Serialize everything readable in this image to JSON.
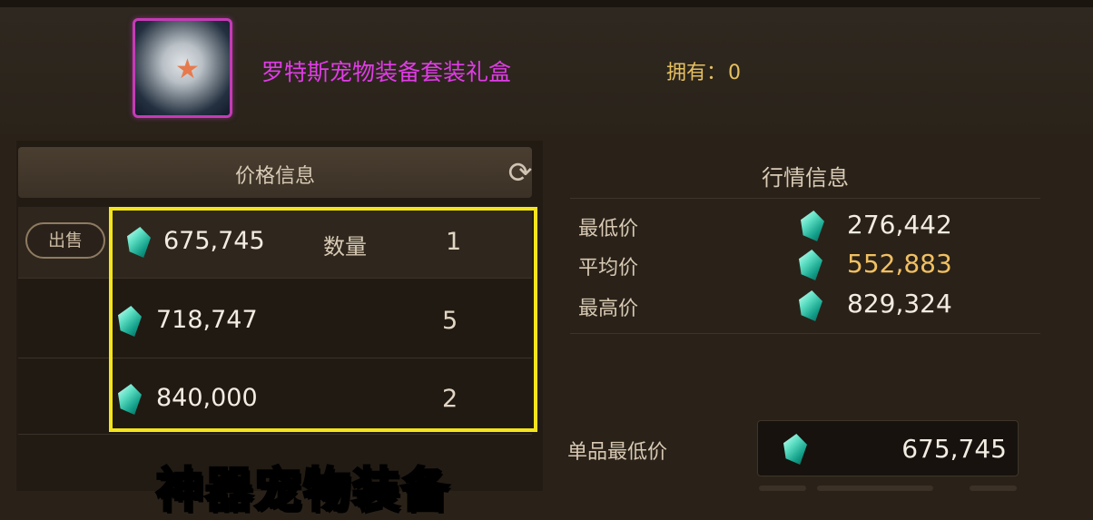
{
  "item": {
    "name": "罗特斯宠物装备套装礼盒",
    "owned_label": "拥有：",
    "owned_value": "0",
    "icon": "clam-shell-gift-box-icon"
  },
  "price_panel": {
    "title": "价格信息",
    "refresh_icon": "refresh-icon",
    "sell_button": "出售",
    "quantity_label": "数量",
    "currency_icon": "teal-crystal-icon",
    "listings": [
      {
        "price": "675,745",
        "quantity": "1"
      },
      {
        "price": "718,747",
        "quantity": "5"
      },
      {
        "price": "840,000",
        "quantity": "2"
      }
    ]
  },
  "market_panel": {
    "title": "行情信息",
    "rows": [
      {
        "label": "最低价",
        "value": "276,442"
      },
      {
        "label": "平均价",
        "value": "552,883"
      },
      {
        "label": "最高价",
        "value": "829,324"
      }
    ],
    "unit_min_label": "单品最低价",
    "unit_min_value": "675,745"
  },
  "overlay_caption": "神器宠物装备",
  "colors": {
    "item_name": "#e03ce6",
    "owned": "#e6c060",
    "highlight_box": "#f4e41c",
    "average_price": "#f1c062",
    "caption": "#ffe51c"
  }
}
